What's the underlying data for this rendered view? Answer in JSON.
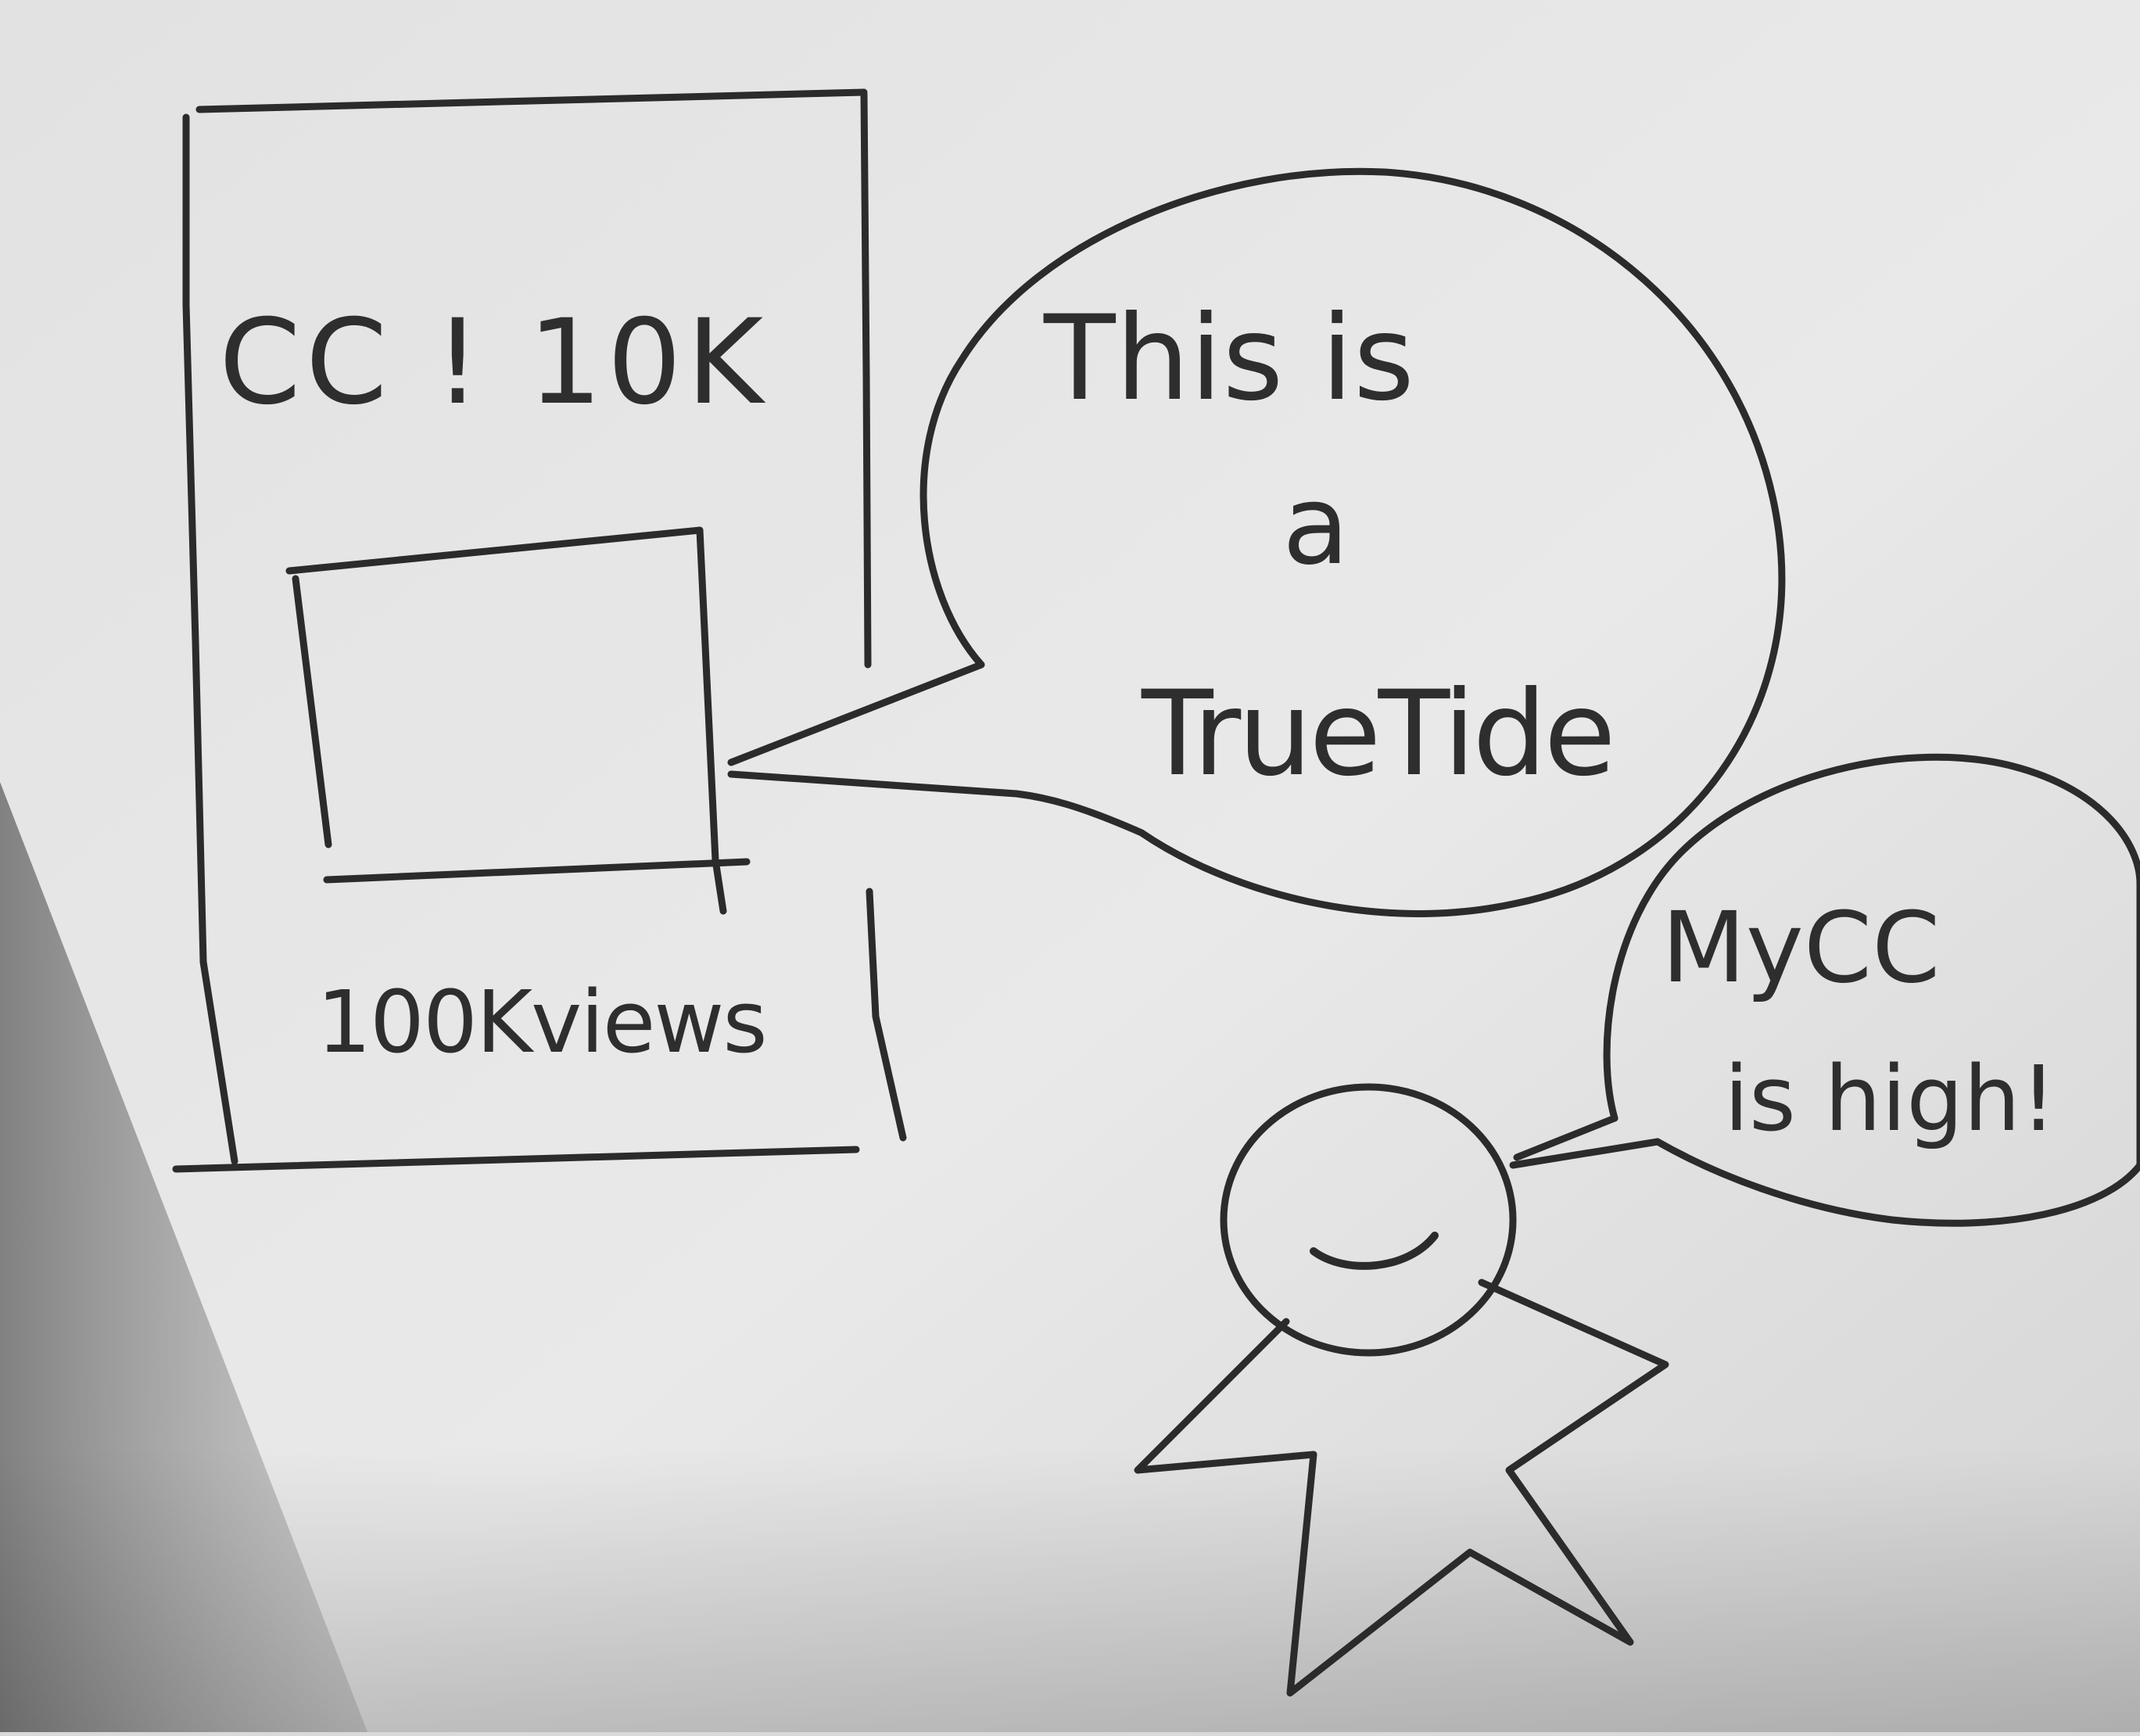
{
  "drawing": {
    "card": {
      "cc_label": "CC ! 10K",
      "views_label": "100Kviews"
    },
    "big_bubble": {
      "line1": "This is",
      "line2": "a",
      "line3": "TrueTide"
    },
    "small_bubble": {
      "line1": "MyCC",
      "line2": "is high!"
    },
    "colors": {
      "paper": "#e6e6e6",
      "ink": "#2b2b2b",
      "shadow": "#8a8a8a"
    }
  }
}
